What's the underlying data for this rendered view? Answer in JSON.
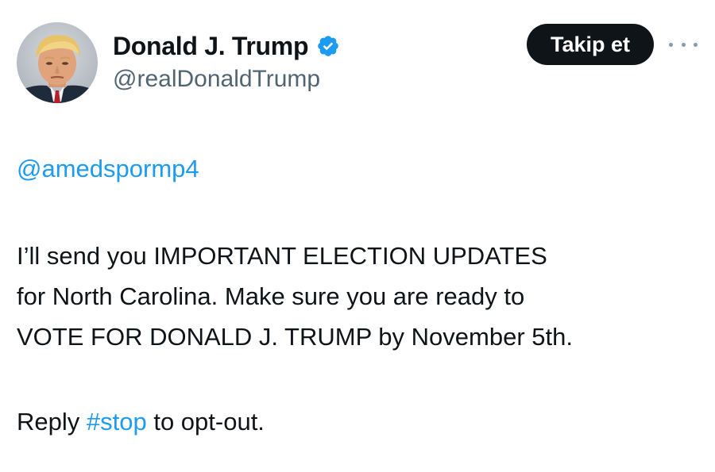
{
  "author": {
    "display_name": "Donald J. Trump",
    "handle": "@realDonaldTrump",
    "verified_icon": "verified-badge-icon",
    "avatar": "profile-photo"
  },
  "actions": {
    "follow_label": "Takip et",
    "more_icon": "more-horizontal-icon"
  },
  "tweet": {
    "mention": "@amedspormp4",
    "body_lines": [
      "I’ll send you IMPORTANT ELECTION UPDATES",
      "for North Carolina. Make sure you are ready to",
      "VOTE FOR DONALD J. TRUMP by November 5th."
    ],
    "reply_prefix": "Reply ",
    "hashtag": "#stop",
    "reply_suffix": " to opt-out."
  },
  "colors": {
    "link": "#1d9bf0",
    "text": "#0f1419",
    "secondary": "#536471",
    "follow_bg": "#0f1419",
    "verified": "#1d9bf0"
  }
}
